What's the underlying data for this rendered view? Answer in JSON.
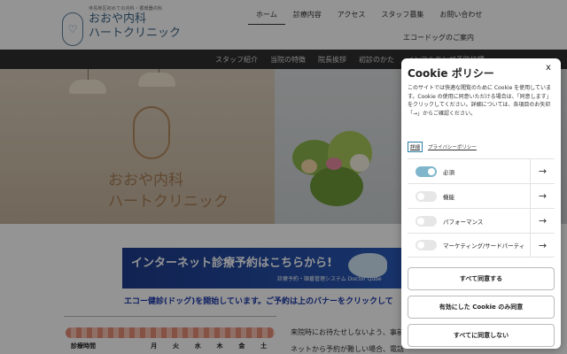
{
  "header": {
    "tagline": "寺島地区初めての内科・循環器内科",
    "clinic_name_line1": "おおや内科",
    "clinic_name_line2": "ハートクリニック",
    "nav": [
      {
        "label": "ホーム"
      },
      {
        "label": "診療内容"
      },
      {
        "label": "アクセス"
      },
      {
        "label": "スタッフ募集"
      },
      {
        "label": "お問い合わせ"
      }
    ],
    "nav_extra": "エコードッグのご案内"
  },
  "subnav": [
    {
      "label": "スタッフ紹介"
    },
    {
      "label": "当院の特徴"
    },
    {
      "label": "院長挨拶"
    },
    {
      "label": "初診のかた"
    },
    {
      "label": "インフルエンザ予防接種"
    }
  ],
  "hero": {
    "sign_line1": "おおや内科",
    "sign_line2": "ハートクリニック"
  },
  "banner": {
    "title": "インターネット診療予約はこちらから!",
    "subtitle": "診療予約・順番管理システム Doctor Qube"
  },
  "notice": "エコー健診(ドッグ)を開始しています。ご予約は上のバナーをクリックして",
  "schedule": {
    "label": "診療時間",
    "days": [
      "月",
      "火",
      "水",
      "木",
      "金",
      "土"
    ]
  },
  "body_text": {
    "line1": "来院時にお待たせしないよう、事前",
    "line2": "ネットから予約が難しい場合、電話"
  },
  "cookie_modal": {
    "title": "Cookie ポリシー",
    "close_symbol": "x",
    "description": "このサイトでは快適な閲覧のために Cookie を使用しています。Cookie の使用に同意いただける場合は、「同意します」をクリックしてください。詳細については、各項目のお矢印「→」からご確認ください。",
    "detail_link": "詳細",
    "policy_link": "プライバシーポリシー",
    "categories": [
      {
        "label": "必須",
        "enabled": true
      },
      {
        "label": "機能",
        "enabled": false
      },
      {
        "label": "パフォーマンス",
        "enabled": false
      },
      {
        "label": "マーケティング/サードパーティ",
        "enabled": false
      }
    ],
    "arrow_symbol": "→",
    "buttons": {
      "accept_all": "すべて同意する",
      "accept_selected": "有効にした Cookie のみ同意",
      "reject_all": "すべてに同意しない"
    }
  },
  "colors": {
    "accent": "#3d6688",
    "toggle_on": "#7fb6cc",
    "banner": "#1d3c8c",
    "notice": "#1a38a8"
  }
}
